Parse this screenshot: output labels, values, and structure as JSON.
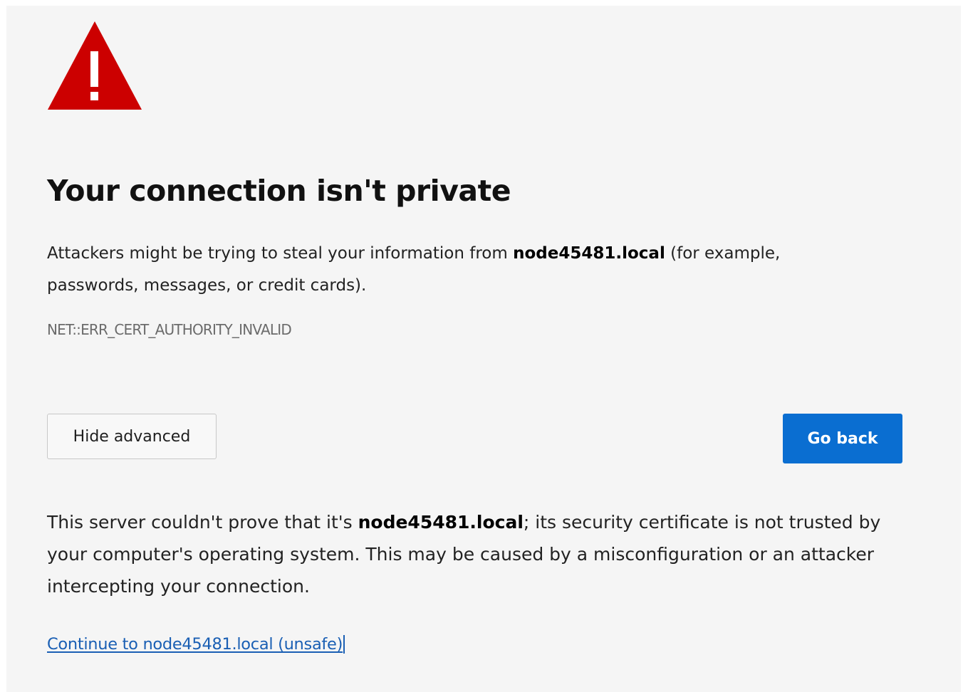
{
  "colors": {
    "page_background": "#f5f5f5",
    "warning_icon": "#cc0000",
    "primary_button": "#0a6ed1",
    "link": "#1a5fb4",
    "error_code_text": "#6b6b6b"
  },
  "icons": {
    "warning": "warning-triangle-exclamation"
  },
  "heading": "Your connection isn't private",
  "intro": {
    "before_host": "Attackers might be trying to steal your information from ",
    "host": "node45481.local",
    "after_host": " (for example, passwords, messages, or credit cards)."
  },
  "error_code": "NET::ERR_CERT_AUTHORITY_INVALID",
  "buttons": {
    "hide_advanced": "Hide advanced",
    "go_back": "Go back"
  },
  "details": {
    "before_host": "This server couldn't prove that it's ",
    "host": "node45481.local",
    "after_host": "; its security certificate is not trusted by your computer's operating system. This may be caused by a misconfiguration or an attacker intercepting your connection."
  },
  "proceed_link": "Continue to node45481.local (unsafe)"
}
